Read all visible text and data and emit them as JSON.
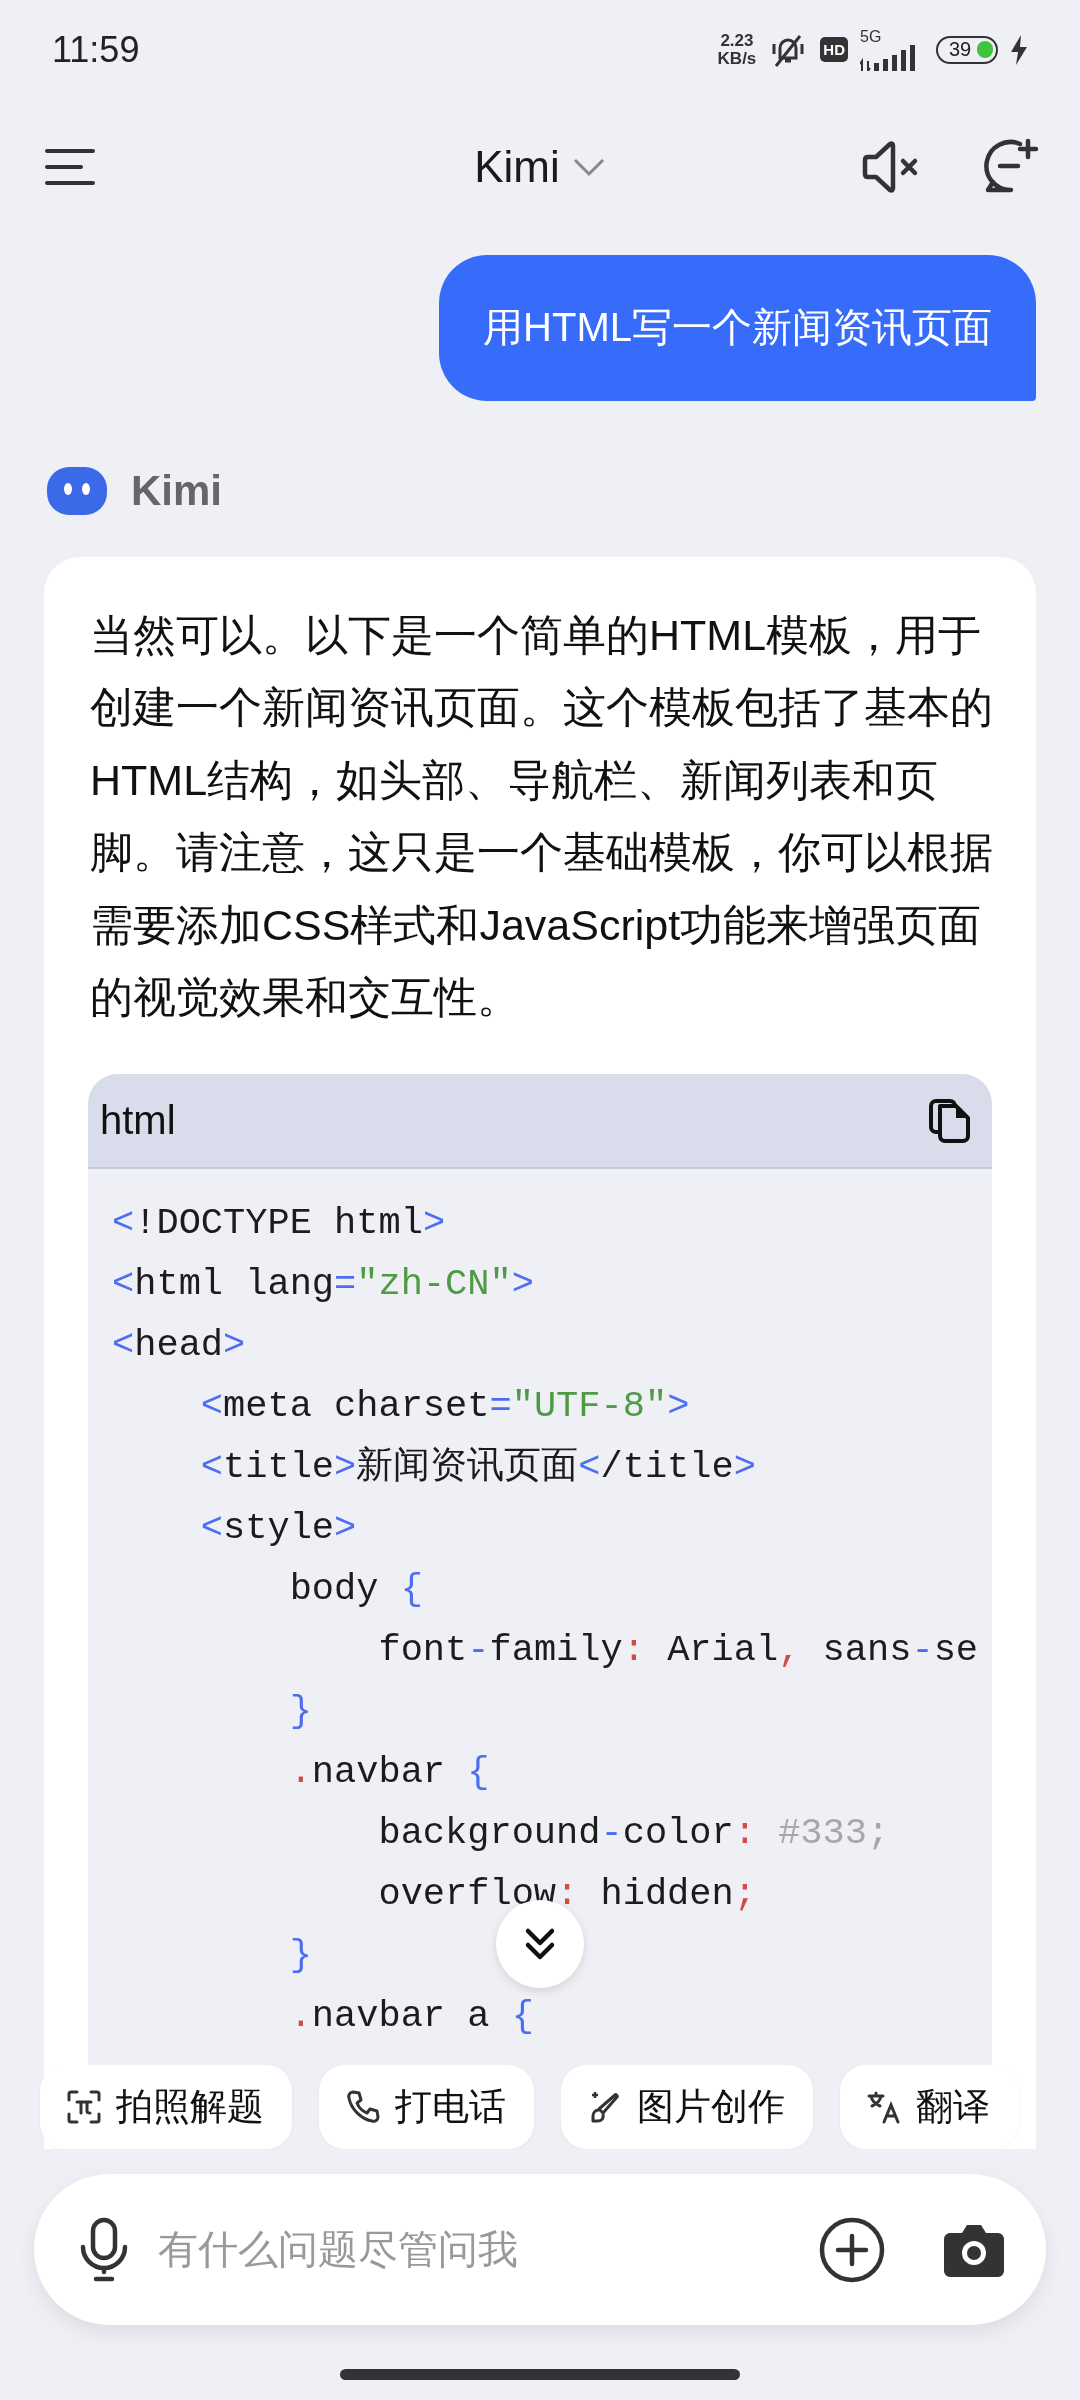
{
  "status_bar": {
    "time": "11:59",
    "net_speed_value": "2.23",
    "net_speed_unit": "KB/s",
    "hd_badge": "HD",
    "network": "5G",
    "battery": "39"
  },
  "header": {
    "title": "Kimi"
  },
  "messages": [
    {
      "kind": "user_message",
      "text": "用HTML写一个新闻资讯页面"
    },
    {
      "kind": "assistant_message",
      "sender": "Kimi",
      "paragraph": "当然可以。以下是一个简单的HTML模板，用于创建一个新闻资讯页面。这个模板包括了基本的HTML结构，如头部、导航栏、新闻列表和页脚。请注意，这只是一个基础模板，你可以根据需要添加CSS样式和JavaScript功能来增强页面的视觉效果和交互性。",
      "code_block": {
        "language": "html",
        "lines": [
          {
            "tokens": [
              {
                "kind": "punct",
                "text": "<"
              },
              {
                "kind": "plain",
                "text": "!DOCTYPE html"
              },
              {
                "kind": "punct",
                "text": ">"
              }
            ]
          },
          {
            "tokens": [
              {
                "kind": "punct",
                "text": "<"
              },
              {
                "kind": "plain",
                "text": "html lang"
              },
              {
                "kind": "punct",
                "text": "="
              },
              {
                "kind": "string",
                "text": "\"zh-CN\""
              },
              {
                "kind": "punct",
                "text": ">"
              }
            ]
          },
          {
            "tokens": [
              {
                "kind": "punct",
                "text": "<"
              },
              {
                "kind": "plain",
                "text": "head"
              },
              {
                "kind": "punct",
                "text": ">"
              }
            ]
          },
          {
            "tokens": [
              {
                "kind": "punct",
                "text": "    <"
              },
              {
                "kind": "plain",
                "text": "meta charset"
              },
              {
                "kind": "punct",
                "text": "="
              },
              {
                "kind": "string",
                "text": "\"UTF-8\""
              },
              {
                "kind": "punct",
                "text": ">"
              }
            ]
          },
          {
            "tokens": [
              {
                "kind": "punct",
                "text": "    <"
              },
              {
                "kind": "plain",
                "text": "title"
              },
              {
                "kind": "punct",
                "text": ">"
              },
              {
                "kind": "plain",
                "text": "新闻资讯页面"
              },
              {
                "kind": "punct",
                "text": "<"
              },
              {
                "kind": "plain",
                "text": "/title"
              },
              {
                "kind": "punct",
                "text": ">"
              }
            ]
          },
          {
            "tokens": [
              {
                "kind": "punct",
                "text": "    <"
              },
              {
                "kind": "plain",
                "text": "style"
              },
              {
                "kind": "punct",
                "text": ">"
              }
            ]
          },
          {
            "tokens": [
              {
                "kind": "plain",
                "text": "        body "
              },
              {
                "kind": "punct",
                "text": "{"
              }
            ]
          },
          {
            "tokens": [
              {
                "kind": "plain",
                "text": "            font"
              },
              {
                "kind": "punct",
                "text": "-"
              },
              {
                "kind": "plain",
                "text": "family"
              },
              {
                "kind": "op",
                "text": ":"
              },
              {
                "kind": "plain",
                "text": " Arial"
              },
              {
                "kind": "op",
                "text": ","
              },
              {
                "kind": "plain",
                "text": " sans"
              },
              {
                "kind": "punct",
                "text": "-"
              },
              {
                "kind": "plain",
                "text": "se"
              }
            ]
          },
          {
            "tokens": [
              {
                "kind": "punct",
                "text": "        }"
              }
            ]
          },
          {
            "tokens": [
              {
                "kind": "op",
                "text": "        ."
              },
              {
                "kind": "plain",
                "text": "navbar "
              },
              {
                "kind": "punct",
                "text": "{"
              }
            ]
          },
          {
            "tokens": [
              {
                "kind": "plain",
                "text": "            background"
              },
              {
                "kind": "punct",
                "text": "-"
              },
              {
                "kind": "plain",
                "text": "color"
              },
              {
                "kind": "op",
                "text": ":"
              },
              {
                "kind": "value",
                "text": " #333;"
              }
            ]
          },
          {
            "tokens": [
              {
                "kind": "plain",
                "text": "            overflow"
              },
              {
                "kind": "op",
                "text": ":"
              },
              {
                "kind": "plain",
                "text": " hidden"
              },
              {
                "kind": "op",
                "text": ";"
              }
            ]
          },
          {
            "tokens": [
              {
                "kind": "punct",
                "text": "        }"
              }
            ]
          },
          {
            "tokens": [
              {
                "kind": "op",
                "text": "        ."
              },
              {
                "kind": "plain",
                "text": "navbar a "
              },
              {
                "kind": "punct",
                "text": "{"
              }
            ]
          }
        ]
      }
    }
  ],
  "quick_actions": [
    {
      "label": "拍照解题"
    },
    {
      "label": "打电话"
    },
    {
      "label": "图片创作"
    },
    {
      "label": "翻译"
    }
  ],
  "input": {
    "placeholder": "有什么问题尽管问我"
  }
}
